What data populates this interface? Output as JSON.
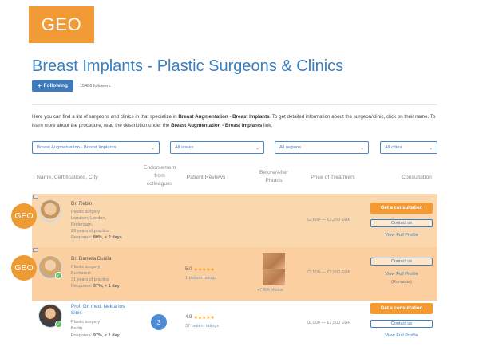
{
  "logo": {
    "text": "GEO"
  },
  "page_title": "Breast Implants - Plastic Surgeons & Clinics",
  "follow": {
    "button_label": "Following",
    "followers": "15486 followers"
  },
  "intro": {
    "p1_a": "Here you can find a list of surgeons and clinics in that specialize in ",
    "p1_b": "Breast Augmentation - Breast Implants",
    "p1_c": ". To get detailed information about the surgeon/clinic, click on their name. To learn more about the procedure, read the description under the ",
    "p1_d": "Breast Augmentation - Breast Implants",
    "p1_e": " link."
  },
  "filters": [
    {
      "value": "Breast Augmentation - Breast Implants"
    },
    {
      "value": "All states"
    },
    {
      "value": "All regions"
    },
    {
      "value": "All cities"
    }
  ],
  "columns": {
    "name": "Name, Certifications, City",
    "endorse_1": "Endorsement",
    "endorse_2": "from",
    "endorse_3": "colleagues",
    "reviews": "Patient Reviews",
    "photos_1": "Before/After",
    "photos_2": "Photos",
    "price": "Price of Treatment",
    "consult": "Consultation"
  },
  "rows": [
    {
      "badge": "GEO",
      "name": "Dr. Rebin",
      "specialty": "Plastic surgery",
      "cities_1": "Lanaken, London,",
      "cities_2": "Rotterdam,",
      "experience": "29 years of practice",
      "response_label": "Response: ",
      "response_value": "80%, < 2 days",
      "price": "€2,600 — €3,250 EUR",
      "consult_label": "Get a consultation",
      "contact_label": "Contact us",
      "profile_label": "View Full Profile"
    },
    {
      "badge": "GEO",
      "name": "Dr. Daniela Bunila",
      "specialty": "Plastic surgery",
      "city": "Bucharest",
      "experience": "31 years of practice",
      "response_label": "Response: ",
      "response_value": "97%, < 1 day",
      "rating": "5.0",
      "stars": "★★★★★",
      "ratings_count": "1 patient ratings",
      "ba_label": "+7 B/A photos",
      "price": "€2,500 — €3,500 EUR",
      "contact_label": "Contact us",
      "profile_label": "View Full Profile",
      "country": "(Romania)"
    },
    {
      "name_1": "Prof. Dr. med. Nektarios",
      "name_2": "Sinis",
      "specialty": "Plastic surgery",
      "city": "Berlin",
      "response_label": "Response: ",
      "response_value": "97%, < 1 day",
      "endorsements": "3",
      "rating": "4.9",
      "stars": "★★★★★",
      "ratings_count": "37 patient ratings",
      "price": "€6,000 — €7,500 EUR",
      "consult_label": "Get a consultation",
      "contact_label": "Contact us",
      "profile_label": "View Full Profile"
    }
  ],
  "colors": {
    "accent_orange": "#f39b32",
    "brand_blue": "#3a7fc1",
    "highlight_row": "#fbd7ae"
  }
}
